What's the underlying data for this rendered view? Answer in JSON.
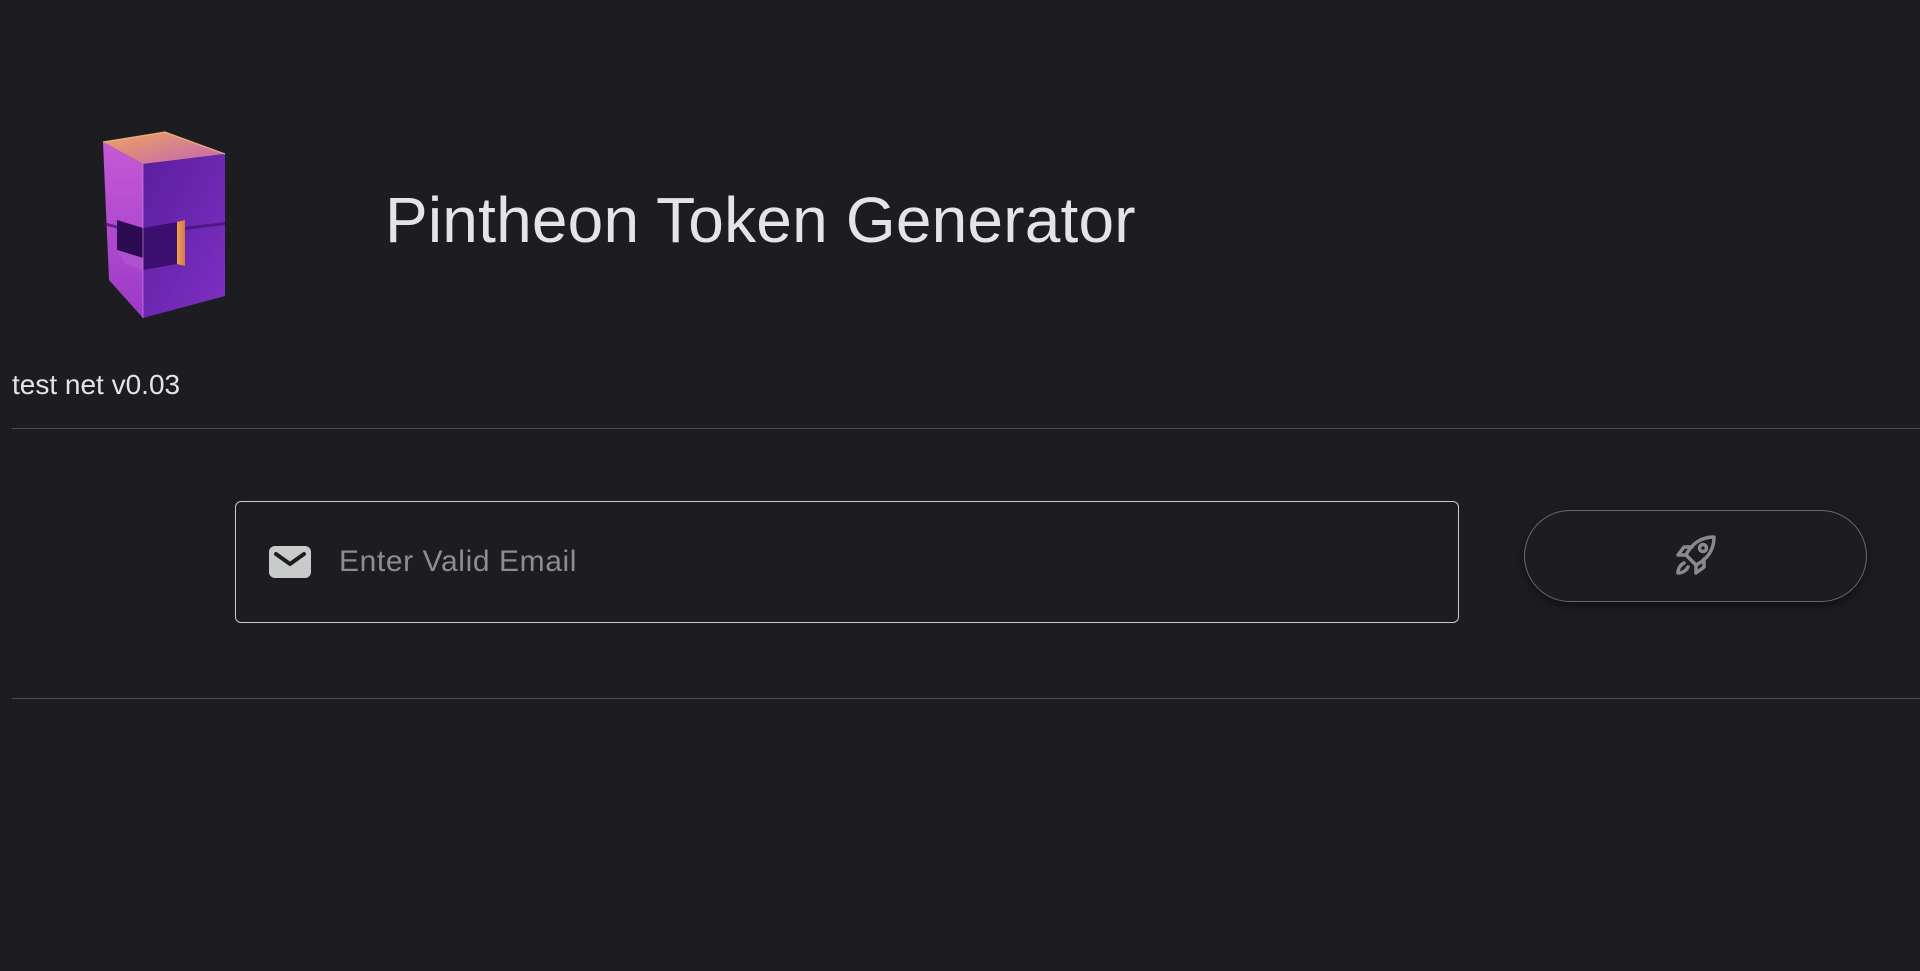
{
  "header": {
    "logo_icon": "cube-logo-icon",
    "title": "Pintheon Token Generator",
    "version": "test net v0.03"
  },
  "form": {
    "email_icon": "envelope-icon",
    "email_placeholder": "Enter Valid Email",
    "email_value": "",
    "submit_icon": "rocket-icon"
  },
  "colors": {
    "background": "#1d1d21",
    "text": "#e4e4e6",
    "logo_purple": "#7a2fc9",
    "logo_orange": "#e89a4a"
  }
}
